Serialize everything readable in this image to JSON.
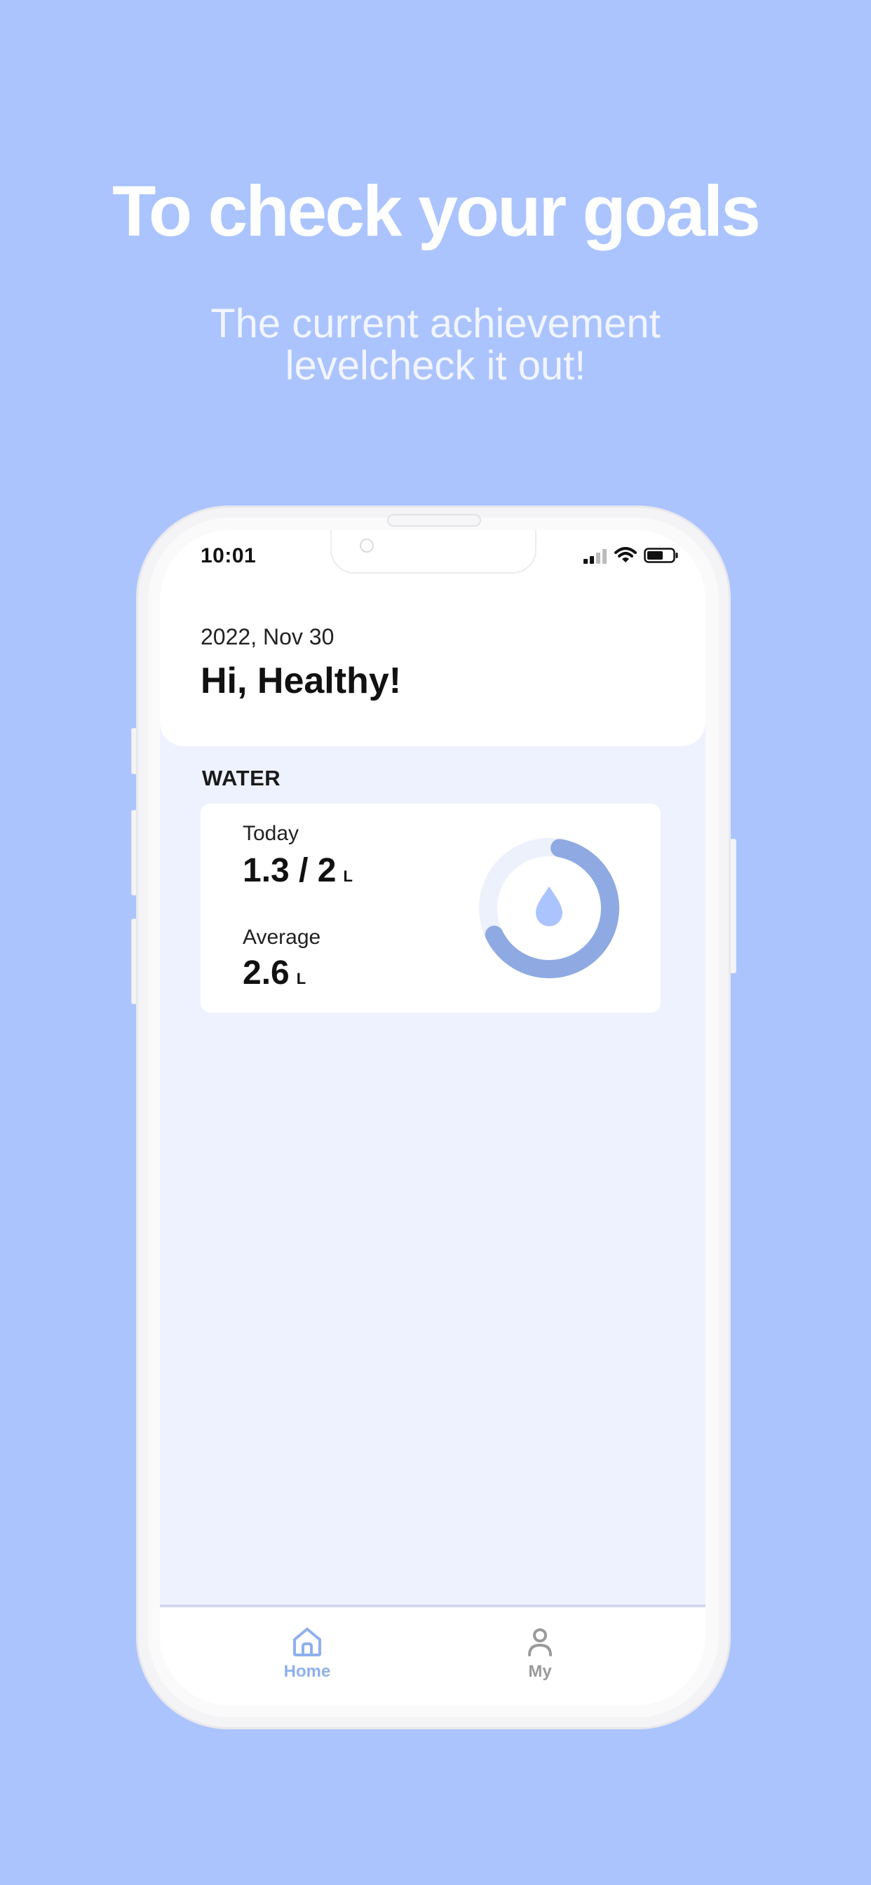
{
  "promo": {
    "headline": "To check your goals",
    "subline_1": "The current achievement",
    "subline_2": "levelcheck it out!"
  },
  "status_bar": {
    "time": "10:01",
    "icons": [
      "signal-icon",
      "wifi-icon",
      "battery-icon"
    ]
  },
  "header": {
    "date": "2022, Nov 30",
    "greeting": "Hi, Healthy!"
  },
  "water": {
    "section_label": "WATER",
    "today_label": "Today",
    "today_value": "1.3 / 2",
    "today_unit": "L",
    "average_label": "Average",
    "average_value": "2.6",
    "average_unit": "L",
    "progress_fraction": 0.65,
    "icon": "water-drop-icon"
  },
  "tabbar": {
    "home_label": "Home",
    "my_label": "My",
    "active": "Home"
  },
  "colors": {
    "background": "#abc4fe",
    "screen_bg": "#eef2ff",
    "accent": "#8fb0ee",
    "ring_progress": "#8fa9e2",
    "ring_track": "#edf1fc"
  }
}
